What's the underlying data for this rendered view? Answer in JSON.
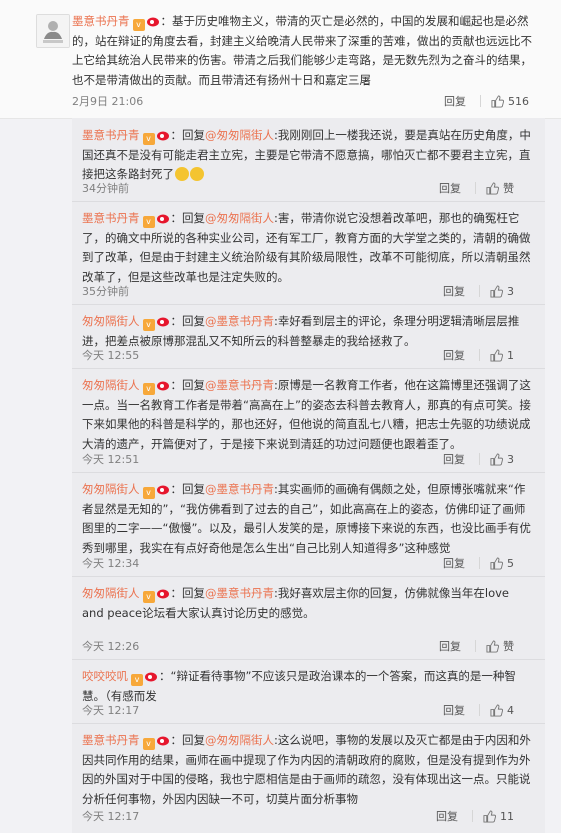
{
  "colors": {
    "accent": "#eb7350",
    "vip": "#f7a83a",
    "bg": "#f2f2f5"
  },
  "main": {
    "avatar_icon": "user-avatar",
    "username": "墨意书丹青",
    "separator": "：",
    "text": "基于历史唯物主义，带清的灭亡是必然的，中国的发展和崛起也是必然的，站在辩证的角度去看，封建主义给晚清人民带来了深重的苦难，做出的贡献也远远比不上它给其统治人民带来的伤害。带清之后我们能够少走弯路，是无数先烈为之奋斗的结果，也不是带清做出的贡献。而且带清还有扬州十日和嘉定三屠",
    "time": "2月9日 21:06",
    "reply_label": "回复",
    "like_count": "516"
  },
  "replies": [
    {
      "username": "墨意书丹青",
      "reply_word": "回复",
      "mention": "@匆匆隔街人",
      "text": "我刚刚回上一楼我还说，要是真站在历史角度，中国还真不是没有可能走君主立宪，主要是它带清不愿意搞，哪怕灭亡都不要君主立宪，直接把这条路封死了",
      "has_emoji": true,
      "time": "34分钟前",
      "reply_label": "回复",
      "like_count": "赞"
    },
    {
      "username": "墨意书丹青",
      "reply_word": "回复",
      "mention": "@匆匆隔街人",
      "text": "害，带清你说它没想着改革吧，那也的确冤枉它了，的确文中所说的各种实业公司，还有军工厂，教育方面的大学堂之类的，清朝的确做到了改革，但是由于封建主义统治阶级有其阶级局限性，改革不可能彻底，所以清朝虽然改革了，但是这些改革也是注定失败的。",
      "has_emoji": false,
      "time": "35分钟前",
      "reply_label": "回复",
      "like_count": "3"
    },
    {
      "username": "匆匆隔街人",
      "reply_word": "回复",
      "mention": "@墨意书丹青",
      "text": "幸好看到层主的评论，条理分明逻辑清晰层层推进，把差点被原博那混乱又不知所云的科普整暴走的我给拯救了。",
      "has_emoji": false,
      "time": "今天 12:55",
      "reply_label": "回复",
      "like_count": "1"
    },
    {
      "username": "匆匆隔街人",
      "reply_word": "回复",
      "mention": "@墨意书丹青",
      "text": "原博是一名教育工作者，他在这篇博里还强调了这一点。当一名教育工作者是带着“高高在上”的姿态去科普去教育人，那真的有点可笑。接下来如果他的科普是科学的，那也还好，但他说的简直乱七八糟，把志士先驱的功绩说成大清的遗产，开篇便对了，于是接下来说到清廷的功过问题便也跟着歪了。",
      "has_emoji": false,
      "time": "今天 12:51",
      "reply_label": "回复",
      "like_count": "3"
    },
    {
      "username": "匆匆隔街人",
      "reply_word": "回复",
      "mention": "@墨意书丹青",
      "text": "其实画师的画确有偶颇之处，但原博张嘴就来“作者显然是无知的”，“我仿佛看到了过去的自己”，如此高高在上的姿态，仿佛印证了画师图里的二字——“傲慢”。以及，最引人发笑的是，原博接下来说的东西，也没比画手有优秀到哪里，我实在有点好奇他是怎么生出“自己比别人知道得多”这种感觉",
      "has_emoji": false,
      "time": "今天 12:34",
      "reply_label": "回复",
      "like_count": "5"
    },
    {
      "username": "匆匆隔街人",
      "reply_word": "回复",
      "mention": "@墨意书丹青",
      "text": "我好喜欢层主你的回复，仿佛就像当年在love and peace论坛看大家认真讨论历史的感觉。",
      "has_emoji": false,
      "time": "今天 12:26",
      "reply_label": "回复",
      "like_count": "赞"
    },
    {
      "username": "咬咬咬叽",
      "reply_word": "",
      "mention": "",
      "text": "“辩证看待事物”不应该只是政治课本的一个答案，而这真的是一种智慧。（有感而发",
      "has_emoji": false,
      "time": "今天 12:17",
      "reply_label": "回复",
      "like_count": "4"
    },
    {
      "username": "墨意书丹青",
      "reply_word": "回复",
      "mention": "@匆匆隔街人",
      "text": "这么说吧，事物的发展以及灭亡都是由于内因和外因共同作用的结果，画师在画中提现了作为内因的清朝政府的腐败，但是没有提到作为外因的外国对于中国的侵略，我也宁愿相信是由于画师的疏忽，没有体现出这一点。只能说分析任何事物，外因内因缺一不可，切莫片面分析事物",
      "has_emoji": false,
      "time": "今天 12:17",
      "reply_label": "回复",
      "like_count": "11"
    }
  ]
}
